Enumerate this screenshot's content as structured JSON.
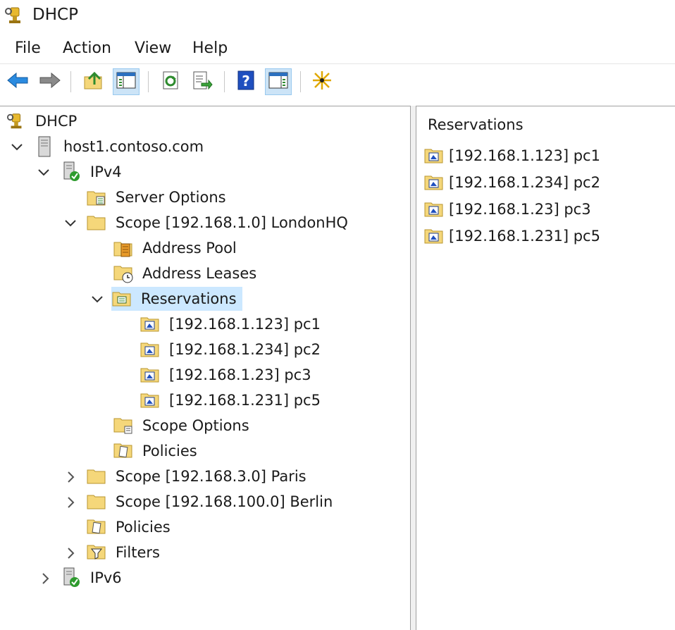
{
  "window": {
    "title": "DHCP"
  },
  "menu": {
    "file": "File",
    "action": "Action",
    "view": "View",
    "help": "Help"
  },
  "toolbar": {
    "icons": [
      "back-arrow-icon",
      "forward-arrow-icon",
      "up-folder-icon",
      "show-hide-console-tree-icon",
      "refresh-icon",
      "export-list-icon",
      "help-icon",
      "show-hide-action-pane-icon",
      "new-star-icon"
    ]
  },
  "tree": {
    "root": "DHCP",
    "server": "host1.contoso.com",
    "ipv4": "IPv4",
    "server_options": "Server Options",
    "scope1": "Scope [192.168.1.0] LondonHQ",
    "address_pool": "Address Pool",
    "address_leases": "Address Leases",
    "reservations": "Reservations",
    "res_items": [
      "[192.168.1.123] pc1",
      "[192.168.1.234] pc2",
      "[192.168.1.23] pc3",
      "[192.168.1.231] pc5"
    ],
    "scope_options": "Scope Options",
    "scope_policies": "Policies",
    "scope2": "Scope [192.168.3.0] Paris",
    "scope3": "Scope [192.168.100.0] Berlin",
    "ipv4_policies": "Policies",
    "filters": "Filters",
    "ipv6": "IPv6"
  },
  "details": {
    "heading": "Reservations",
    "items": [
      "[192.168.1.123] pc1",
      "[192.168.1.234] pc2",
      "[192.168.1.23] pc3",
      "[192.168.1.231] pc5"
    ]
  },
  "colors": {
    "selection": "#cce8ff",
    "pressed": "#cce4f7",
    "folder": "#f5d77a",
    "accent_blue": "#1e6fd9"
  }
}
